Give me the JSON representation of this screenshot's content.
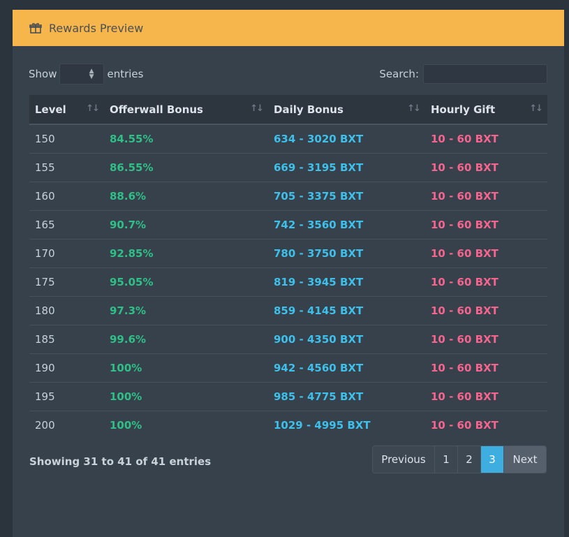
{
  "header": {
    "title": "Rewards Preview",
    "icon": "gift-icon"
  },
  "controls": {
    "show_label": "Show",
    "entries_label": "entries",
    "search_label": "Search:",
    "search_value": ""
  },
  "table": {
    "columns": [
      "Level",
      "Offerwall Bonus",
      "Daily Bonus",
      "Hourly Gift"
    ],
    "rows": [
      {
        "level": "150",
        "offerwall": "84.55%",
        "daily": "634 - 3020 BXT",
        "hourly": "10 - 60 BXT"
      },
      {
        "level": "155",
        "offerwall": "86.55%",
        "daily": "669 - 3195 BXT",
        "hourly": "10 - 60 BXT"
      },
      {
        "level": "160",
        "offerwall": "88.6%",
        "daily": "705 - 3375 BXT",
        "hourly": "10 - 60 BXT"
      },
      {
        "level": "165",
        "offerwall": "90.7%",
        "daily": "742 - 3560 BXT",
        "hourly": "10 - 60 BXT"
      },
      {
        "level": "170",
        "offerwall": "92.85%",
        "daily": "780 - 3750 BXT",
        "hourly": "10 - 60 BXT"
      },
      {
        "level": "175",
        "offerwall": "95.05%",
        "daily": "819 - 3945 BXT",
        "hourly": "10 - 60 BXT"
      },
      {
        "level": "180",
        "offerwall": "97.3%",
        "daily": "859 - 4145 BXT",
        "hourly": "10 - 60 BXT"
      },
      {
        "level": "185",
        "offerwall": "99.6%",
        "daily": "900 - 4350 BXT",
        "hourly": "10 - 60 BXT"
      },
      {
        "level": "190",
        "offerwall": "100%",
        "daily": "942 - 4560 BXT",
        "hourly": "10 - 60 BXT"
      },
      {
        "level": "195",
        "offerwall": "100%",
        "daily": "985 - 4775 BXT",
        "hourly": "10 - 60 BXT"
      },
      {
        "level": "200",
        "offerwall": "100%",
        "daily": "1029 - 4995 BXT",
        "hourly": "10 - 60 BXT"
      }
    ]
  },
  "footer": {
    "info": "Showing 31 to 41 of 41 entries",
    "pagination": {
      "previous": "Previous",
      "pages": [
        "1",
        "2",
        "3"
      ],
      "active": "3",
      "next": "Next"
    }
  },
  "colors": {
    "header_bg": "#f7b64b",
    "offerwall": "#2fbf87",
    "daily": "#3ec0ea",
    "hourly": "#f7648d",
    "active_page": "#3eaee0"
  }
}
